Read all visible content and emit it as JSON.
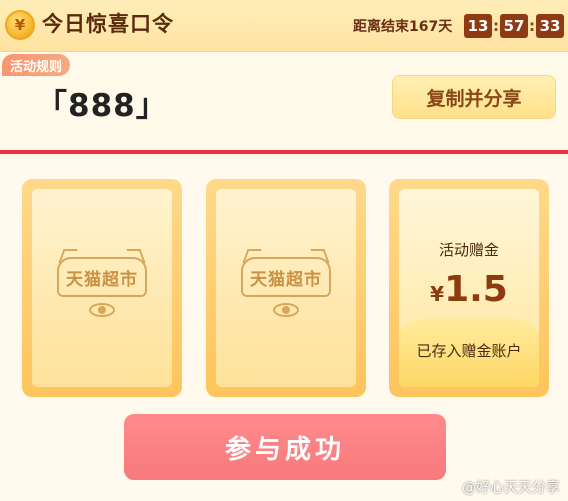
{
  "header": {
    "coin_symbol": "¥",
    "title": "今日惊喜口令",
    "countdown_label": "距离结束167天",
    "countdown": {
      "hours": "13",
      "minutes": "57",
      "seconds": "33"
    }
  },
  "code_panel": {
    "rules_label": "活动规则",
    "code": "「888」",
    "copy_button_label": "复制并分享"
  },
  "cards": [
    {
      "brand_label": "天猫超市"
    },
    {
      "brand_label": "天猫超市"
    }
  ],
  "revealed_card": {
    "label": "活动赠金",
    "currency": "¥",
    "amount": "1.5",
    "status": "已存入赠金账户"
  },
  "success_button_label": "参与成功",
  "watermark": "@好心天天分享",
  "colors": {
    "accent_red": "#ef3047",
    "timer_bg": "#8e3a12",
    "button_red": "#f7797b",
    "card_gold": "#ffc45c"
  }
}
